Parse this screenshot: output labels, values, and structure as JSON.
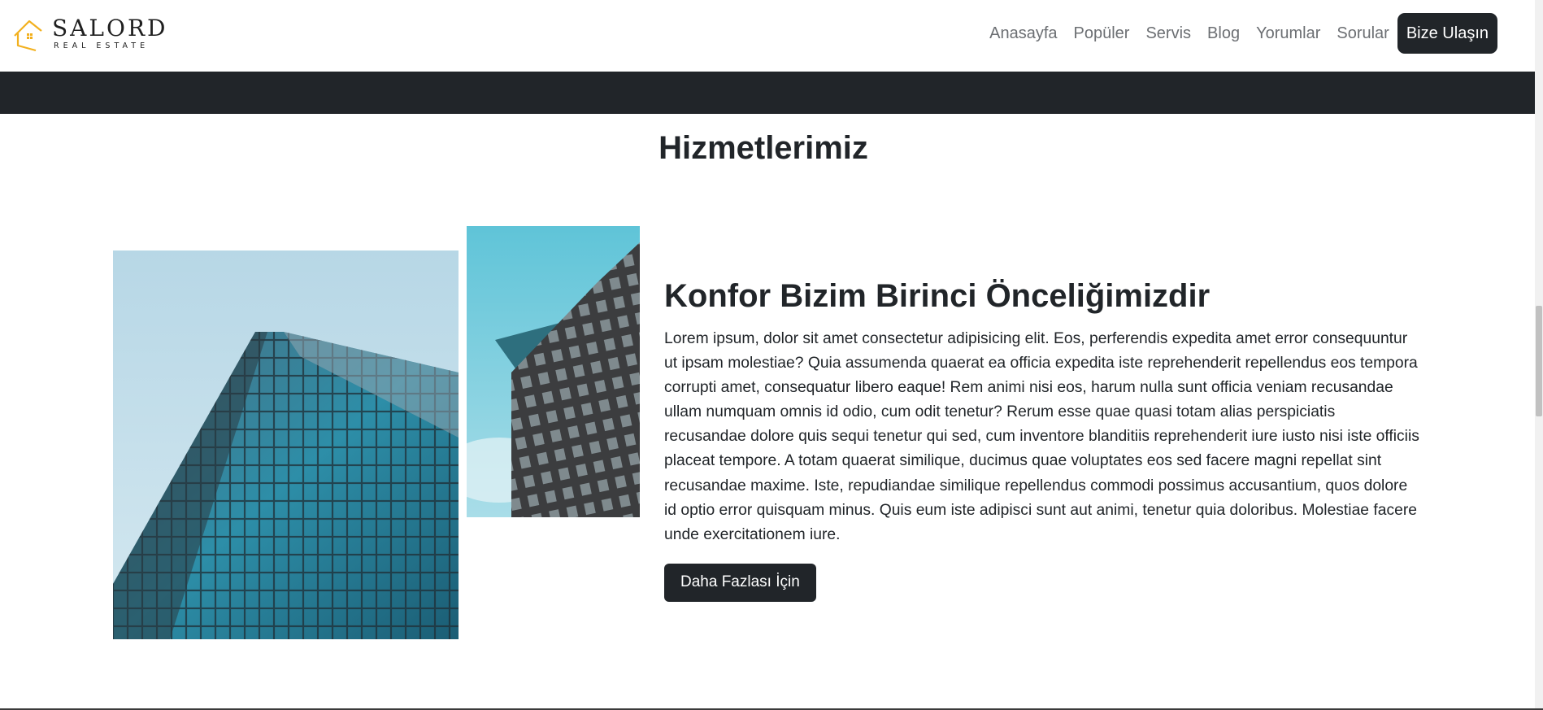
{
  "brand": {
    "name": "SALORD",
    "tagline": "REAL ESTATE",
    "accent": "#f2b01e"
  },
  "nav": {
    "links": [
      "Anasayfa",
      "Popüler",
      "Servis",
      "Blog",
      "Yorumlar",
      "Sorular"
    ],
    "cta": "Bize Ulaşın"
  },
  "section": {
    "title": "Hizmetlerimiz",
    "heading": "Konfor Bizim Birinci Önceliğimizdir",
    "body": "Lorem ipsum, dolor sit amet consectetur adipisicing elit. Eos, perferendis expedita amet error consequuntur ut ipsam molestiae? Quia assumenda quaerat ea officia expedita iste reprehenderit repellendus eos tempora corrupti amet, consequatur libero eaque! Rem animi nisi eos, harum nulla sunt officia veniam recusandae ullam numquam omnis id odio, cum odit tenetur? Rerum esse quae quasi totam alias perspiciatis recusandae dolore quis sequi tenetur qui sed, cum inventore blanditiis reprehenderit iure iusto nisi iste officiis placeat tempore. A totam quaerat similique, ducimus quae voluptates eos sed facere magni repellat sint recusandae maxime. Iste, repudiandae similique repellendus commodi possimus accusantium, quos dolore id optio error quisquam minus. Quis eum iste adipisci sunt aut animi, tenetur quia doloribus. Molestiae facere unde exercitationem iure.",
    "button": "Daha Fazlası İçin"
  },
  "colors": {
    "dark": "#212529",
    "nav_text": "#6c6f73"
  }
}
